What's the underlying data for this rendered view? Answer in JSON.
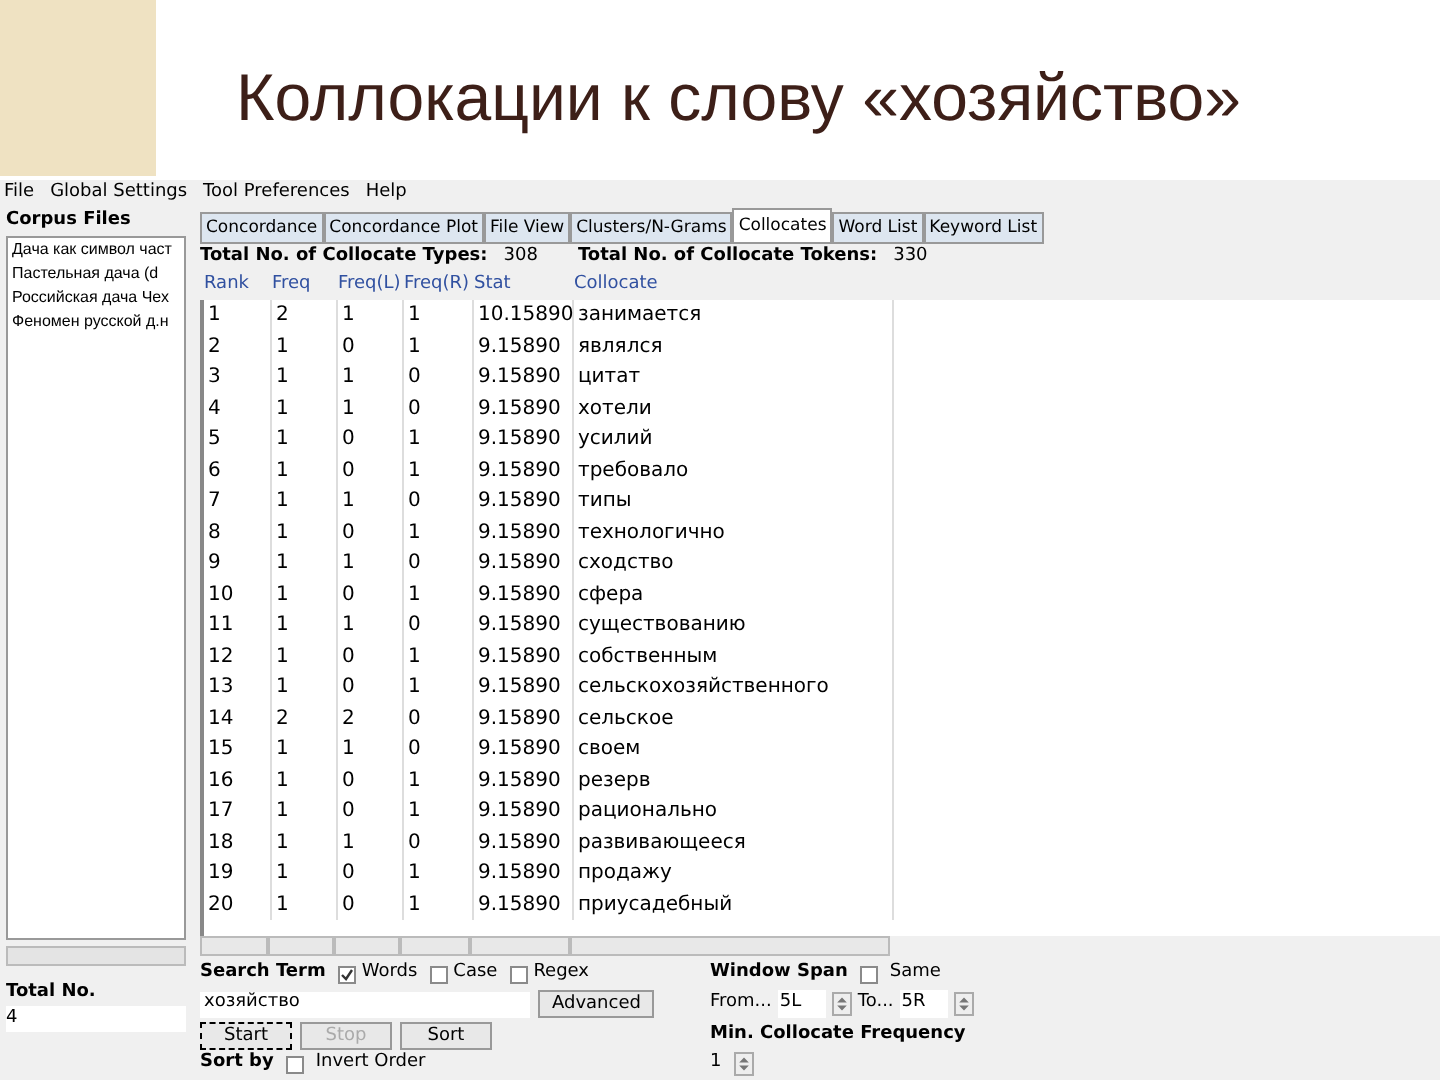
{
  "slide": {
    "title": "Коллокации к слову «хозяйство»"
  },
  "menu": [
    "File",
    "Global Settings",
    "Tool Preferences",
    "Help"
  ],
  "sidebar": {
    "title": "Corpus Files",
    "files": [
      "Дача как символ част",
      "Пастельная дача (d",
      "Российская дача Чех",
      "Феномен русской д.н"
    ],
    "total_label": "Total No.",
    "total_value": "4"
  },
  "tabs": [
    {
      "label": "Concordance",
      "selected": false
    },
    {
      "label": "Concordance Plot",
      "selected": false
    },
    {
      "label": "File View",
      "selected": false
    },
    {
      "label": "Clusters/N-Grams",
      "selected": false
    },
    {
      "label": "Collocates",
      "selected": true
    },
    {
      "label": "Word List",
      "selected": false
    },
    {
      "label": "Keyword List",
      "selected": false
    }
  ],
  "totals": [
    {
      "label": "Total No. of Collocate Types:",
      "value": "308"
    },
    {
      "label": "Total No. of Collocate Tokens:",
      "value": "330"
    }
  ],
  "table": {
    "columns": [
      "Rank",
      "Freq",
      "Freq(L)",
      "Freq(R)",
      "Stat",
      "Collocate"
    ],
    "rows": [
      [
        "1",
        "2",
        "1",
        "1",
        "10.15890",
        "занимается"
      ],
      [
        "2",
        "1",
        "0",
        "1",
        "9.15890",
        "являлся"
      ],
      [
        "3",
        "1",
        "1",
        "0",
        "9.15890",
        "цитат"
      ],
      [
        "4",
        "1",
        "1",
        "0",
        "9.15890",
        "хотели"
      ],
      [
        "5",
        "1",
        "0",
        "1",
        "9.15890",
        "усилий"
      ],
      [
        "6",
        "1",
        "0",
        "1",
        "9.15890",
        "требовало"
      ],
      [
        "7",
        "1",
        "1",
        "0",
        "9.15890",
        "типы"
      ],
      [
        "8",
        "1",
        "0",
        "1",
        "9.15890",
        "технологично"
      ],
      [
        "9",
        "1",
        "1",
        "0",
        "9.15890",
        "сходство"
      ],
      [
        "10",
        "1",
        "0",
        "1",
        "9.15890",
        "сфера"
      ],
      [
        "11",
        "1",
        "1",
        "0",
        "9.15890",
        "существованию"
      ],
      [
        "12",
        "1",
        "0",
        "1",
        "9.15890",
        "собственным"
      ],
      [
        "13",
        "1",
        "0",
        "1",
        "9.15890",
        "сельскохозяйственного"
      ],
      [
        "14",
        "2",
        "2",
        "0",
        "9.15890",
        "сельское"
      ],
      [
        "15",
        "1",
        "1",
        "0",
        "9.15890",
        "своем"
      ],
      [
        "16",
        "1",
        "0",
        "1",
        "9.15890",
        "резерв"
      ],
      [
        "17",
        "1",
        "0",
        "1",
        "9.15890",
        "рационально"
      ],
      [
        "18",
        "1",
        "1",
        "0",
        "9.15890",
        "развивающееся"
      ],
      [
        "19",
        "1",
        "0",
        "1",
        "9.15890",
        "продажу"
      ],
      [
        "20",
        "1",
        "0",
        "1",
        "9.15890",
        "приусадебный"
      ]
    ]
  },
  "search": {
    "label": "Search Term",
    "options": [
      {
        "label": "Words",
        "checked": true
      },
      {
        "label": "Case",
        "checked": false
      },
      {
        "label": "Regex",
        "checked": false
      }
    ],
    "value": "хозяйство",
    "advanced": "Advanced",
    "buttons": [
      {
        "label": "Start",
        "disabled": false,
        "focused": true
      },
      {
        "label": "Stop",
        "disabled": true,
        "focused": false
      },
      {
        "label": "Sort",
        "disabled": false,
        "focused": false
      }
    ],
    "sort_label": "Sort by",
    "invert": {
      "label": "Invert Order",
      "checked": false
    }
  },
  "window_span": {
    "label": "Window Span",
    "same": {
      "label": "Same",
      "checked": false
    },
    "from_label": "From...",
    "from_value": "5L",
    "to_label": "To...",
    "to_value": "5R"
  },
  "min_freq": {
    "label": "Min. Collocate Frequency",
    "value": "1"
  }
}
